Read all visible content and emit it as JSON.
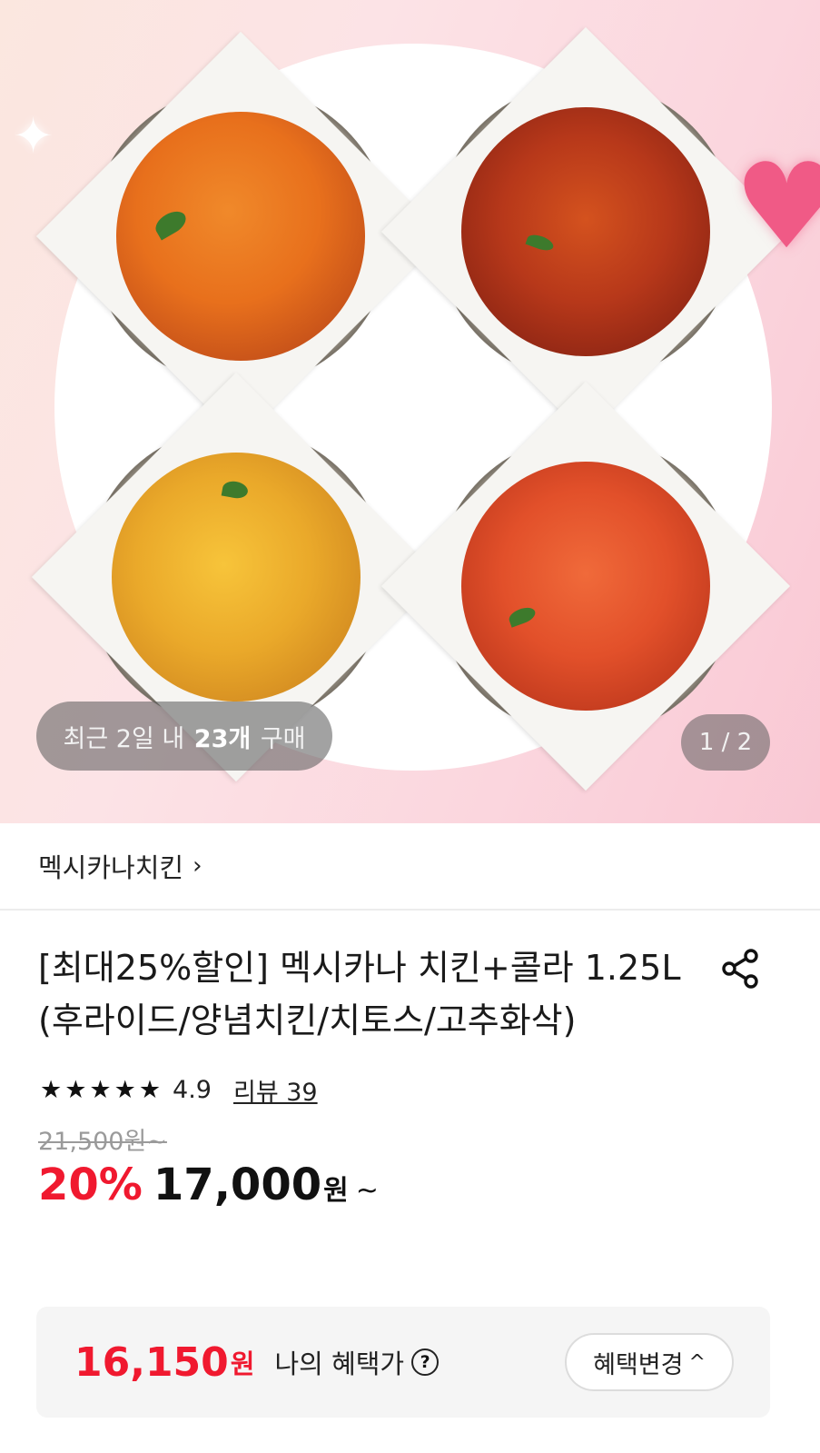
{
  "hero": {
    "purchase_badge": {
      "prefix": "최근 2일 내",
      "count": "23개",
      "suffix": "구매"
    },
    "pager": "1 / 2",
    "images": [
      "fried-chicken",
      "seasoned-chicken",
      "cheetos-chicken",
      "spicy-chicken"
    ]
  },
  "brand": {
    "name": "멕시카나치킨",
    "chevron": "›"
  },
  "product": {
    "title": "[최대25%할인] 멕시카나 치킨+콜라 1.25L (후라이드/양념치킨/치토스/고추화삭)",
    "share_icon": "share-icon"
  },
  "rating": {
    "stars": "★★★★★",
    "score": "4.9",
    "review_label": "리뷰 39"
  },
  "pricing": {
    "original": "21,500원~",
    "discount_pct": "20%",
    "price": "17,000",
    "won": "원",
    "tilde": "~"
  },
  "benefit": {
    "price": "16,150",
    "won": "원",
    "label": "나의 혜택가",
    "help": "?",
    "button_label": "혜택변경",
    "button_chevron": "^"
  },
  "colors": {
    "accent": "#f0192f",
    "text": "#111111",
    "muted": "#9a9a9a"
  }
}
